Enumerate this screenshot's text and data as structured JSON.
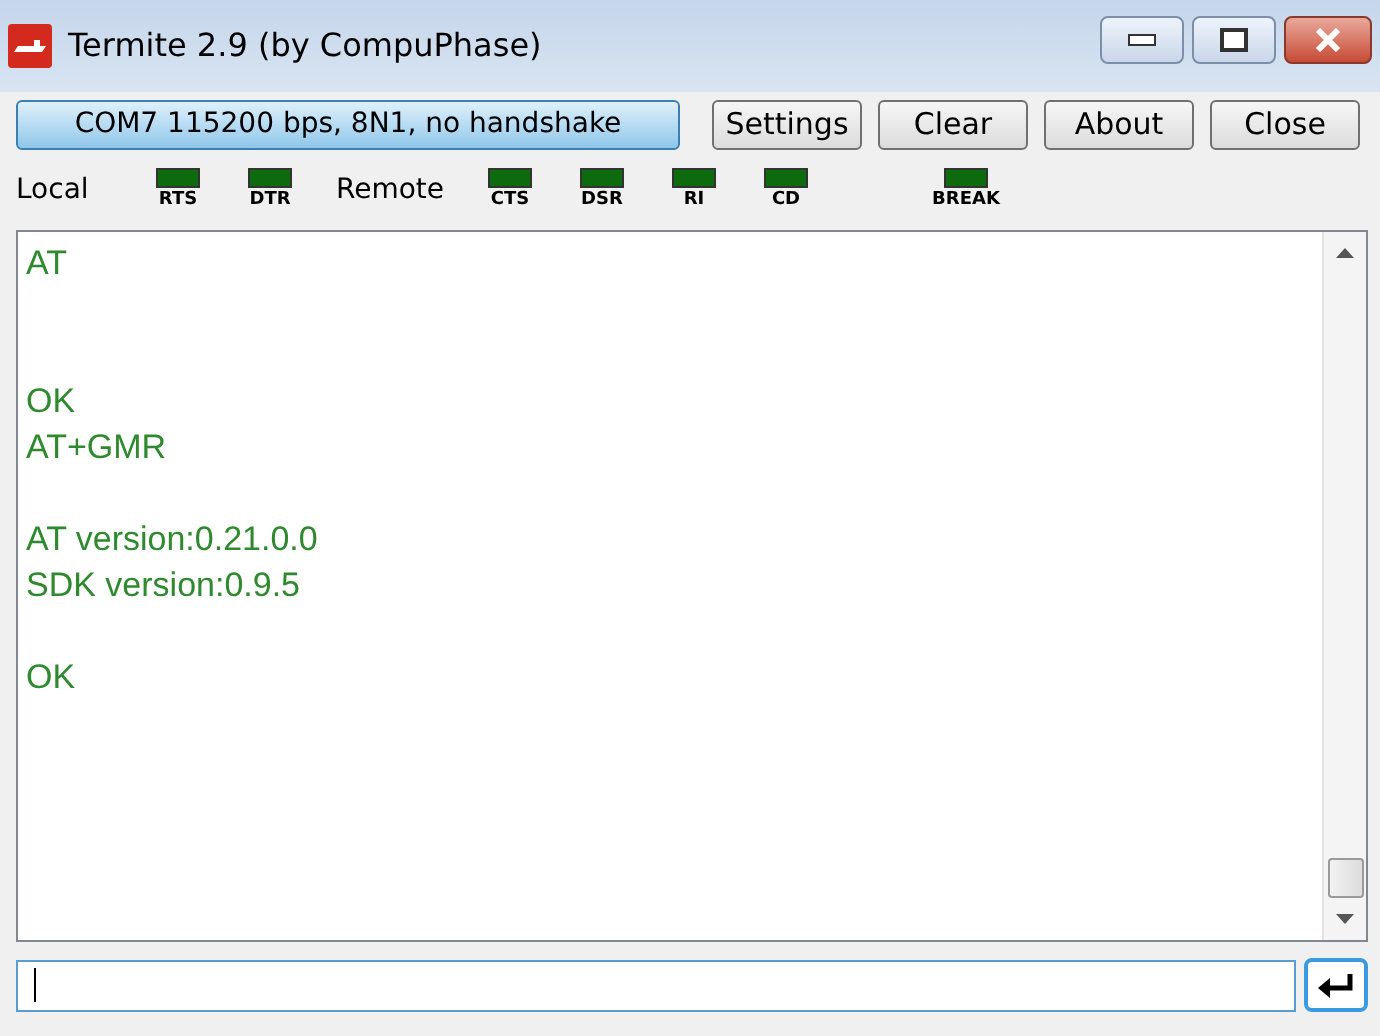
{
  "window": {
    "title": "Termite 2.9 (by CompuPhase)"
  },
  "toolbar": {
    "port_button": "COM7 115200 bps, 8N1, no handshake",
    "buttons": [
      "Settings",
      "Clear",
      "About",
      "Close"
    ]
  },
  "local": {
    "label": "Local",
    "leds": [
      {
        "label": "RTS",
        "on": false
      },
      {
        "label": "DTR",
        "on": false
      }
    ]
  },
  "remote": {
    "label": "Remote",
    "leds": [
      {
        "label": "CTS",
        "on": false
      },
      {
        "label": "DSR",
        "on": false
      },
      {
        "label": "RI",
        "on": false
      },
      {
        "label": "CD",
        "on": false
      }
    ]
  },
  "break_led": {
    "label": "BREAK",
    "on": false
  },
  "terminal": {
    "lines": [
      {
        "kind": "text",
        "text": "AT"
      },
      {
        "kind": "blank"
      },
      {
        "kind": "blank"
      },
      {
        "kind": "text",
        "text": "OK"
      },
      {
        "kind": "text",
        "text": "AT+GMR"
      },
      {
        "kind": "blank"
      },
      {
        "kind": "text",
        "text": "AT version:0.21.0.0"
      },
      {
        "kind": "text",
        "text": "SDK version:0.9.5"
      },
      {
        "kind": "blank"
      },
      {
        "kind": "text",
        "text": "OK"
      }
    ]
  },
  "input": {
    "focused": true
  }
}
